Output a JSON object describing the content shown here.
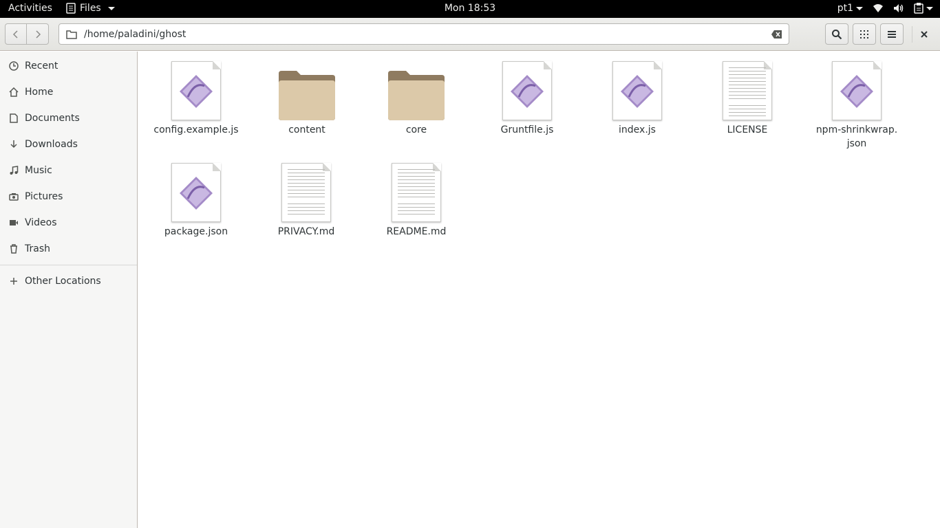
{
  "topbar": {
    "activities": "Activities",
    "app_name": "Files",
    "clock": "Mon 18:53",
    "input_method": "pt1"
  },
  "headerbar": {
    "path": "/home/paladini/ghost"
  },
  "sidebar": {
    "items": [
      {
        "label": "Recent",
        "icon": "clock-icon"
      },
      {
        "label": "Home",
        "icon": "home-icon"
      },
      {
        "label": "Documents",
        "icon": "document-icon"
      },
      {
        "label": "Downloads",
        "icon": "download-icon"
      },
      {
        "label": "Music",
        "icon": "music-icon"
      },
      {
        "label": "Pictures",
        "icon": "camera-icon"
      },
      {
        "label": "Videos",
        "icon": "video-icon"
      },
      {
        "label": "Trash",
        "icon": "trash-icon"
      }
    ],
    "other_locations": "Other Locations"
  },
  "files": [
    {
      "name": "config.example.js",
      "type": "script"
    },
    {
      "name": "content",
      "type": "folder"
    },
    {
      "name": "core",
      "type": "folder"
    },
    {
      "name": "Gruntfile.js",
      "type": "script"
    },
    {
      "name": "index.js",
      "type": "script"
    },
    {
      "name": "LICENSE",
      "type": "text"
    },
    {
      "name": "npm-shrinkwrap.\njson",
      "type": "script"
    },
    {
      "name": "package.json",
      "type": "script"
    },
    {
      "name": "PRIVACY.md",
      "type": "text"
    },
    {
      "name": "README.md",
      "type": "text"
    }
  ],
  "colors": {
    "topbar_bg": "#000000",
    "sidebar_bg": "#f6f6f5",
    "folder": "#d8c6a6",
    "script_diamond": "#a48bc8"
  }
}
